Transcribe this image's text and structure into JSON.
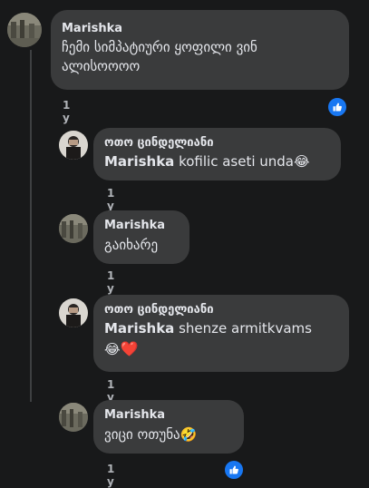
{
  "comments": [
    {
      "author": "Marishka",
      "text": "ჩემი სიმპატიური ყოფილი ვინ ალისოოოო",
      "time": "1 y"
    },
    {
      "author": "ოთო ცინდელიანი",
      "mention": "Marishka",
      "text": "kofilic aseti unda",
      "emoji": "😂",
      "time": "1 y"
    },
    {
      "author": "Marishka",
      "text": "გაიხარე",
      "time": "1 y"
    },
    {
      "author": "ოთო ცინდელიანი",
      "mention": "Marishka",
      "text": "shenze armitkvams",
      "emoji": "😂",
      "emoji2": "❤️",
      "time": "1 y"
    },
    {
      "author": "Marishka",
      "text": "ვიცი ოთუნა",
      "emoji": "🤣",
      "time": "1 y"
    }
  ],
  "colors": {
    "background": "#18191a",
    "bubble": "#3a3b3c",
    "like": "#1877f2"
  },
  "icons": {
    "reaction": "like-thumb-icon"
  }
}
